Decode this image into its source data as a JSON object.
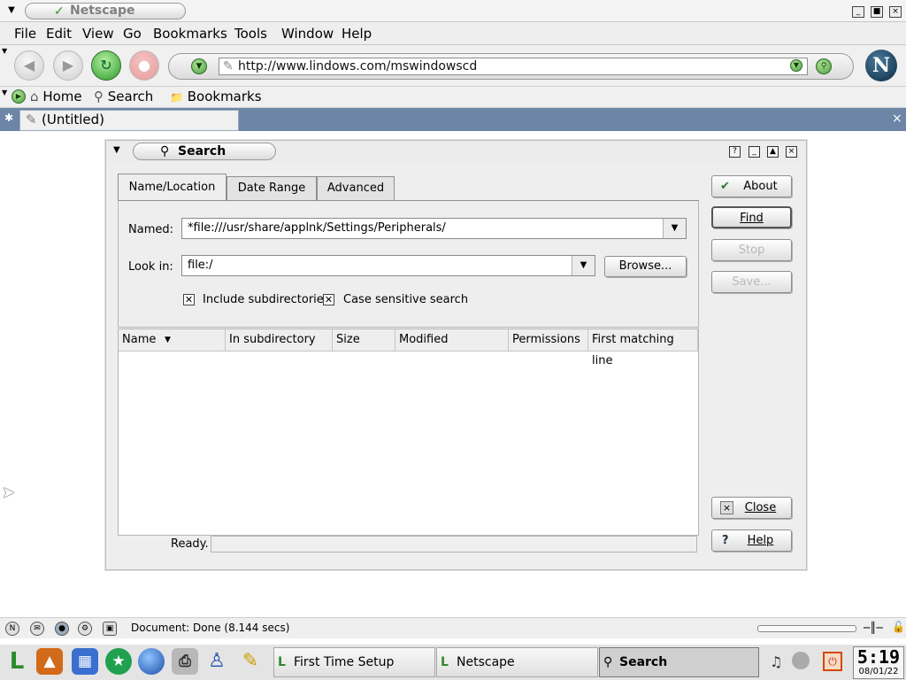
{
  "window": {
    "title": "Netscape"
  },
  "menubar": {
    "items": [
      "File",
      "Edit",
      "View",
      "Go",
      "Bookmarks",
      "Tools",
      "Window",
      "Help"
    ]
  },
  "nav": {
    "url": "http://www.lindows.com/mswindowscd"
  },
  "personal_toolbar": {
    "home": "Home",
    "search": "Search",
    "bookmarks": "Bookmarks"
  },
  "tabs": {
    "current": "(Untitled)"
  },
  "search_dialog": {
    "title": "Search",
    "tabs": [
      "Name/Location",
      "Date Range",
      "Advanced"
    ],
    "named_label": "Named:",
    "named_value": "*file:///usr/share/applnk/Settings/Peripherals/",
    "lookin_label": "Look in:",
    "lookin_value": "file:/",
    "browse_label": "Browse...",
    "include_subdirs_label": "Include subdirectories",
    "case_sensitive_label": "Case sensitive search",
    "include_subdirs_checked": true,
    "case_sensitive_checked": true,
    "columns": [
      "Name",
      "In subdirectory",
      "Size",
      "Modified",
      "Permissions",
      "First matching line"
    ],
    "status": "Ready.",
    "buttons": {
      "about": "About",
      "find": "Find",
      "stop": "Stop",
      "save": "Save...",
      "close": "Close",
      "help": "Help"
    }
  },
  "statusbar": {
    "text": "Document: Done (8.144 secs)"
  },
  "taskbar": {
    "tasks": [
      "First Time Setup",
      "Netscape",
      "Search"
    ],
    "clock_time": "5:19",
    "clock_date": "08/01/22"
  },
  "colors": {
    "accent": "#6d86a8",
    "tab_bg": "#e3e3e3"
  },
  "icons": [
    "close-icon",
    "maximize-icon",
    "minimize-icon",
    "back-icon",
    "forward-icon",
    "reload-icon",
    "stop-icon",
    "netscape-logo-icon",
    "home-icon",
    "search-icon",
    "bookmarks-icon",
    "help-icon",
    "checkmark-icon"
  ]
}
